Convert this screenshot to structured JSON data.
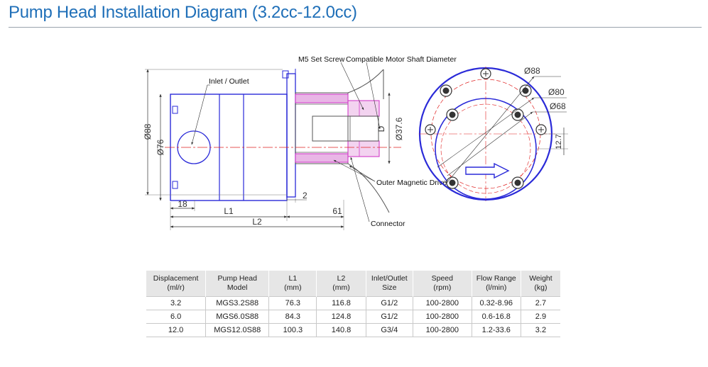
{
  "title": "Pump Head Installation Diagram (3.2cc-12.0cc)",
  "labels": {
    "inlet_outlet": "Inlet / Outlet",
    "m5_set_screw": "M5 Set Screw",
    "motor_shaft": "Compatible Motor Shaft Diameter",
    "outer_drive": "Outer Magnetic Drive",
    "connector": "Connector",
    "d88_side": "Ø88",
    "d76_side": "Ø76",
    "d37_6": "Ø37.6",
    "shaft_d": "D",
    "dim_18": "18",
    "dim_l1": "L1",
    "dim_l2": "L2",
    "dim_61": "61",
    "dim_2": "2",
    "d88_front": "Ø88",
    "d80_front": "Ø80",
    "d68_front": "Ø68",
    "dim_12_7": "12.7"
  },
  "colors": {
    "title": "#1f6fb8",
    "outline": "#2a2ad8",
    "magnet": "#d23cc8",
    "centerline": "#e02020",
    "dimension": "#333333"
  },
  "table": {
    "headers": [
      [
        "Displacement",
        "(ml/r)"
      ],
      [
        "Pump Head",
        "Model"
      ],
      [
        "L1",
        "(mm)"
      ],
      [
        "L2",
        "(mm)"
      ],
      [
        "Inlet/Outlet",
        "Size"
      ],
      [
        "Speed",
        "(rpm)"
      ],
      [
        "Flow Range",
        "(l/min)"
      ],
      [
        "Weight",
        "(kg)"
      ]
    ],
    "rows": [
      [
        "3.2",
        "MGS3.2S88",
        "76.3",
        "116.8",
        "G1/2",
        "100-2800",
        "0.32-8.96",
        "2.7"
      ],
      [
        "6.0",
        "MGS6.0S88",
        "84.3",
        "124.8",
        "G1/2",
        "100-2800",
        "0.6-16.8",
        "2.9"
      ],
      [
        "12.0",
        "MGS12.0S88",
        "100.3",
        "140.8",
        "G3/4",
        "100-2800",
        "1.2-33.6",
        "3.2"
      ]
    ]
  }
}
